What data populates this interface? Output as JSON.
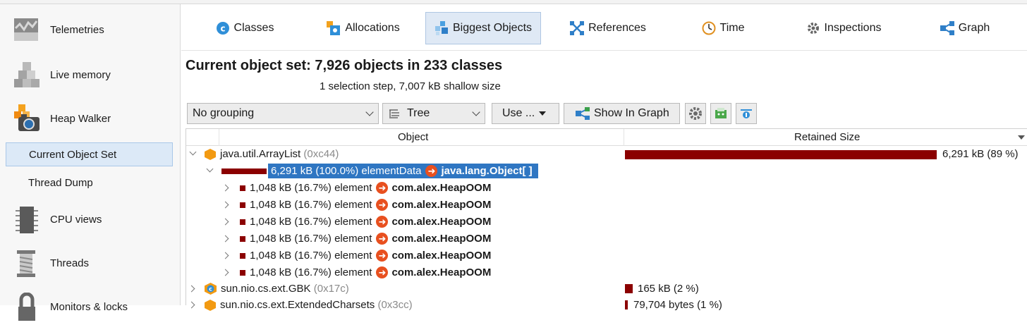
{
  "sidebar": {
    "items": [
      {
        "label": "Telemetries",
        "icon": "telemetries-icon"
      },
      {
        "label": "Live memory",
        "icon": "live-memory-icon"
      },
      {
        "label": "Heap Walker",
        "icon": "heap-walker-icon"
      },
      {
        "label": "CPU views",
        "icon": "cpu-views-icon"
      },
      {
        "label": "Threads",
        "icon": "threads-icon"
      },
      {
        "label": "Monitors & locks",
        "icon": "monitors-icon"
      }
    ],
    "sub_items": [
      {
        "label": "Current Object Set",
        "selected": true
      },
      {
        "label": "Thread Dump",
        "selected": false
      }
    ]
  },
  "tabs": [
    {
      "label": "Classes",
      "icon": "classes-icon"
    },
    {
      "label": "Allocations",
      "icon": "allocations-icon"
    },
    {
      "label": "Biggest Objects",
      "icon": "biggest-objects-icon",
      "active": true
    },
    {
      "label": "References",
      "icon": "references-icon"
    },
    {
      "label": "Time",
      "icon": "time-icon"
    },
    {
      "label": "Inspections",
      "icon": "inspections-icon"
    },
    {
      "label": "Graph",
      "icon": "graph-icon"
    }
  ],
  "header": {
    "title": "Current object set:  7,926 objects in 233 classes",
    "subtitle": "1 selection step, 7,007 kB shallow size"
  },
  "toolbar": {
    "grouping": "No grouping",
    "view": "Tree",
    "use_label": "Use ...",
    "show_in_graph": "Show In Graph"
  },
  "table": {
    "columns": [
      "Object",
      "Retained Size"
    ],
    "rows": [
      {
        "name": "java.util.ArrayList",
        "addr": "(0xc44)",
        "size": "6,291 kB (89 %)",
        "fraction": 0.89
      },
      {
        "field": "6,291 kB (100.0%) elementData",
        "target": "java.lang.Object[ ]"
      },
      {
        "field": "1,048 kB (16.7%) element",
        "target": "com.alex.HeapOOM"
      },
      {
        "field": "1,048 kB (16.7%) element",
        "target": "com.alex.HeapOOM"
      },
      {
        "field": "1,048 kB (16.7%) element",
        "target": "com.alex.HeapOOM"
      },
      {
        "field": "1,048 kB (16.7%) element",
        "target": "com.alex.HeapOOM"
      },
      {
        "field": "1,048 kB (16.7%) element",
        "target": "com.alex.HeapOOM"
      },
      {
        "field": "1,048 kB (16.7%) element",
        "target": "com.alex.HeapOOM"
      },
      {
        "name": "sun.nio.cs.ext.GBK",
        "addr": "(0x17c)",
        "size": "165 kB (2 %)",
        "fraction": 0.02
      },
      {
        "name": "sun.nio.cs.ext.ExtendedCharsets",
        "addr": "(0x3cc)",
        "size": "79,704 bytes (1 %)",
        "fraction": 0.01
      }
    ]
  },
  "colors": {
    "bar": "#8b0000",
    "selection": "#2f76c2",
    "arrow_badge": "#e8501f"
  }
}
